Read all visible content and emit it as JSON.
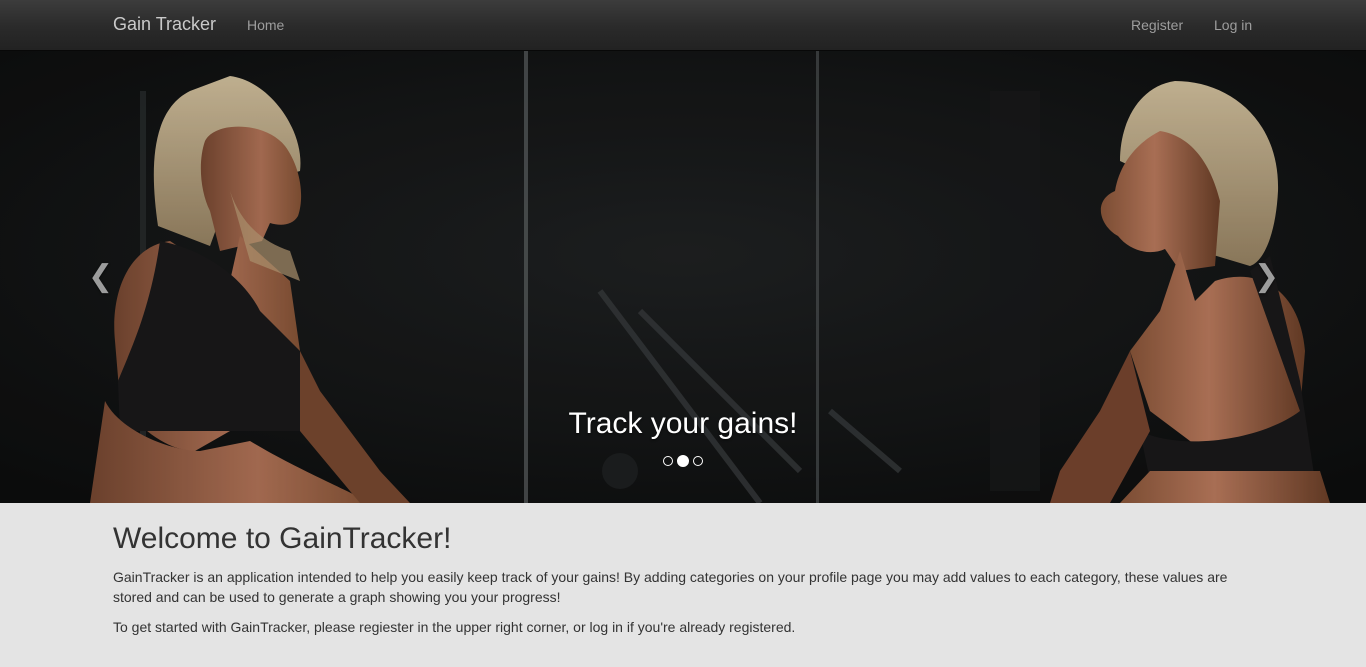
{
  "navbar": {
    "brand": "Gain Tracker",
    "home": "Home",
    "register": "Register",
    "login": "Log in"
  },
  "carousel": {
    "caption": "Track your gains!",
    "prev_icon": "chevron-left-icon",
    "next_icon": "chevron-right-icon",
    "slide_count": 3,
    "active_slide": 2
  },
  "main": {
    "title": "Welcome to GainTracker!",
    "paragraphs": [
      "GainTracker is an application intended to help you easily keep track of your gains! By adding categories on your profile page you may add values to each category, these values are stored and can be used to generate a graph showing you your progress!",
      "To get started with GainTracker, please regiester in the upper right corner, or log in if you're already registered."
    ]
  },
  "colors": {
    "navbar_bg": "#2a2a2a",
    "nav_text": "#9d9d9d",
    "page_bg": "#e4e4e4"
  }
}
